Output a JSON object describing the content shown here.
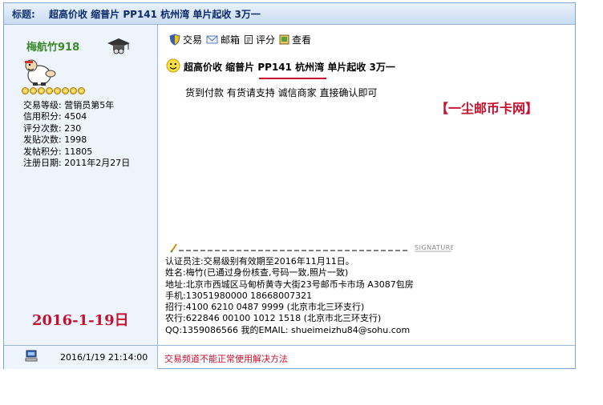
{
  "title_bar": {
    "label": "标题:",
    "title": "超高价收 缩普片 PP141 杭州湾 单片起收 3万一"
  },
  "user": {
    "name": "梅航竹918",
    "stats": [
      {
        "label": "交易等级:",
        "value": "营销员第5年"
      },
      {
        "label": "信用积分:",
        "value": "4504"
      },
      {
        "label": "评分次数:",
        "value": "230"
      },
      {
        "label": "发贴次数:",
        "value": "1998"
      },
      {
        "label": "发帖积分:",
        "value": "11805"
      },
      {
        "label": "注册日期:",
        "value": "2011年2月27日"
      }
    ],
    "date_stamp": "2016-1-19日"
  },
  "toolbar": {
    "trade": "交易",
    "mail": "邮箱",
    "rate": "评分",
    "view": "查看"
  },
  "post": {
    "subject": "超高价收 缩普片 PP141 杭州湾 单片起收 3万一",
    "body": "货到付款 有货请支持 诚信商家 直接确认即可",
    "watermark": "【一尘邮币卡网】",
    "signature_label": "SIGNATURE",
    "signature_lines": [
      "认证员注:交易级别有效期至2016年11月11日。",
      "姓名:梅竹(已通过身份核查,号码一致,照片一致)",
      "地址:北京市西城区马甸桥黄寺大街23号邮币卡市场 A3087包房",
      "手机:13051980000 18668007321",
      "招行:4100 6210 0487 9999  (北京市北三环支行)",
      "农行:622846 00100 1012 1518 (北京市北三环支行)",
      "QQ:1359086566 我的EMAIL: shueimeizhu84@sohu.com"
    ]
  },
  "footer": {
    "timestamp": "2016/1/19 21:14:00",
    "link": "交易频道不能正常使用解决方法"
  },
  "colors": {
    "accent": "#c8102e",
    "username": "#3a8a2a",
    "border": "#7fa6d0"
  }
}
